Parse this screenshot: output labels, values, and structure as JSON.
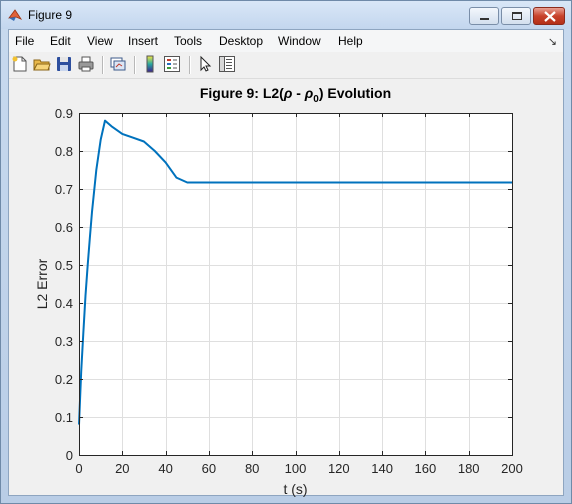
{
  "window": {
    "title": "Figure 9"
  },
  "menu": {
    "items": [
      "File",
      "Edit",
      "View",
      "Insert",
      "Tools",
      "Desktop",
      "Window",
      "Help"
    ],
    "dock_glyph": "↘"
  },
  "toolbar": {
    "icons": [
      "new-figure-icon",
      "open-file-icon",
      "save-icon",
      "print-icon",
      "link-plot-icon",
      "insert-colorbar-icon",
      "insert-legend-icon",
      "pointer-icon",
      "property-inspector-icon"
    ]
  },
  "colors": {
    "line": "#0072bd",
    "grid": "#dfdfdf",
    "axes": "#262626"
  },
  "chart_data": {
    "type": "line",
    "title": "Figure 9: L2(ρ - ρ0) Evolution",
    "title_parts": {
      "prefix": "Figure 9: L2(",
      "rho": "ρ",
      "minus": " - ",
      "rho0": "ρ",
      "sub": "0",
      "suffix": ") Evolution"
    },
    "xlabel": "t (s)",
    "ylabel": "L2 Error",
    "xlim": [
      0,
      200
    ],
    "ylim": [
      0,
      0.9
    ],
    "xticks": [
      0,
      20,
      40,
      60,
      80,
      100,
      120,
      140,
      160,
      180,
      200
    ],
    "yticks": [
      0,
      0.1,
      0.2,
      0.3,
      0.4,
      0.5,
      0.6,
      0.7,
      0.8,
      0.9
    ],
    "grid": true,
    "series": [
      {
        "x": [
          0,
          0.5,
          1,
          2,
          3,
          4,
          5,
          6,
          8,
          10,
          12,
          15,
          20,
          25,
          30,
          35,
          40,
          45,
          50,
          60,
          80,
          100,
          120,
          140,
          160,
          180,
          200
        ],
        "y": [
          0.08,
          0.15,
          0.22,
          0.32,
          0.42,
          0.5,
          0.57,
          0.64,
          0.75,
          0.83,
          0.88,
          0.865,
          0.845,
          0.835,
          0.825,
          0.8,
          0.77,
          0.73,
          0.717,
          0.717,
          0.717,
          0.717,
          0.717,
          0.717,
          0.717,
          0.717,
          0.717
        ]
      }
    ]
  }
}
